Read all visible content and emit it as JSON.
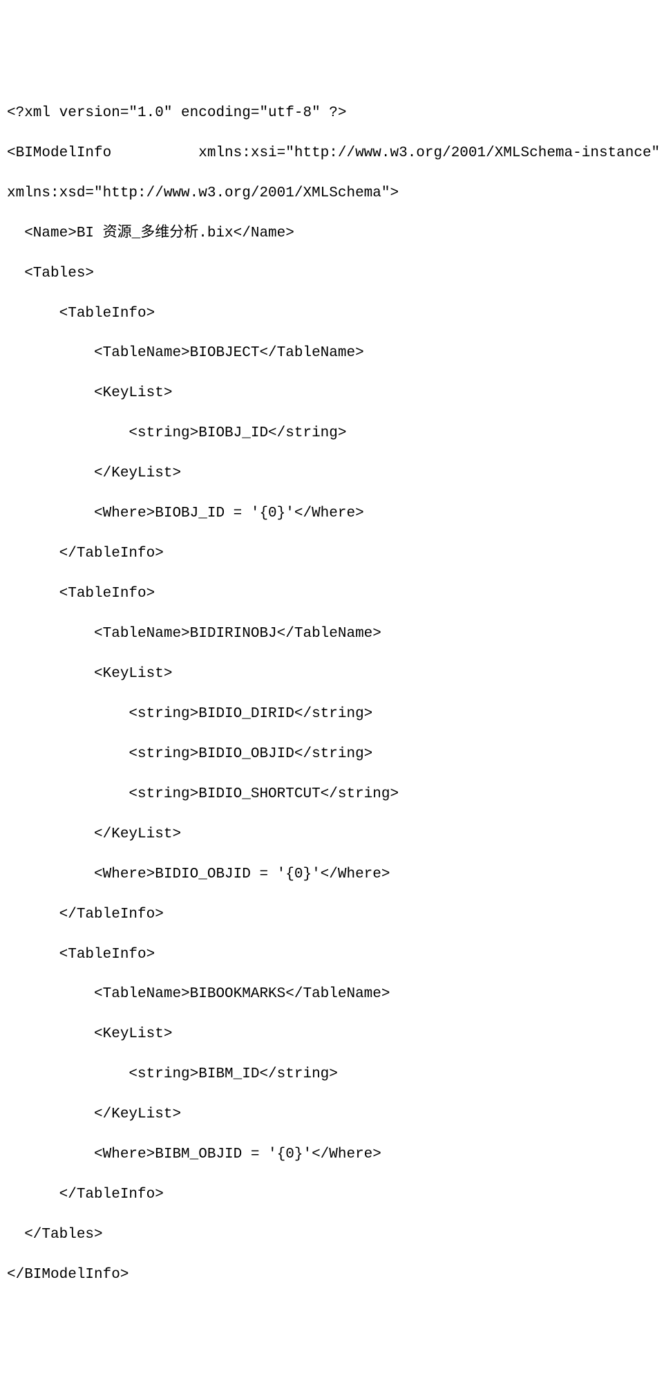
{
  "xml": {
    "line1": "<?xml version=\"1.0\" encoding=\"utf-8\" ?>",
    "line2": "<BIModelInfo          xmlns:xsi=\"http://www.w3.org/2001/XMLSchema-instance\"",
    "line3": "xmlns:xsd=\"http://www.w3.org/2001/XMLSchema\">",
    "line4": "  <Name>BI 资源_多维分析.bix</Name>",
    "line5": "  <Tables>",
    "line6": "      <TableInfo>",
    "line7": "          <TableName>BIOBJECT</TableName>",
    "line8": "          <KeyList>",
    "line9": "              <string>BIOBJ_ID</string>",
    "line10": "          </KeyList>",
    "line11": "          <Where>BIOBJ_ID = '{0}'</Where>",
    "line12": "      </TableInfo>",
    "line13": "      <TableInfo>",
    "line14": "          <TableName>BIDIRINOBJ</TableName>",
    "line15": "          <KeyList>",
    "line16": "              <string>BIDIO_DIRID</string>",
    "line17": "              <string>BIDIO_OBJID</string>",
    "line18": "              <string>BIDIO_SHORTCUT</string>",
    "line19": "          </KeyList>",
    "line20": "          <Where>BIDIO_OBJID = '{0}'</Where>",
    "line21": "      </TableInfo>",
    "line22": "      <TableInfo>",
    "line23": "          <TableName>BIBOOKMARKS</TableName>",
    "line24": "          <KeyList>",
    "line25": "              <string>BIBM_ID</string>",
    "line26": "          </KeyList>",
    "line27": "          <Where>BIBM_OBJID = '{0}'</Where>",
    "line28": "      </TableInfo>",
    "line29": "  </Tables>",
    "line30": "</BIModelInfo>"
  }
}
